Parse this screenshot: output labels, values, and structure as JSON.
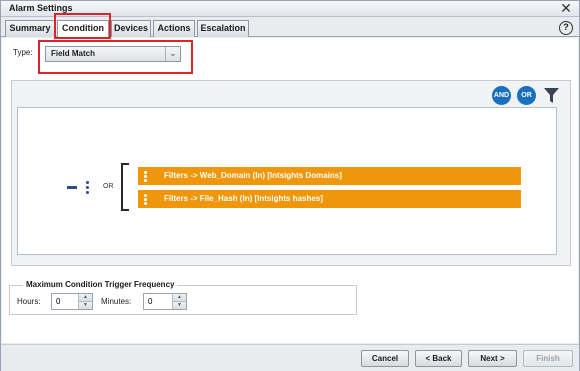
{
  "window": {
    "title": "Alarm Settings",
    "close_glyph": "✕",
    "help_glyph": "?"
  },
  "tabs": [
    {
      "label": "Summary"
    },
    {
      "label": "Condition",
      "active": true
    },
    {
      "label": "Devices"
    },
    {
      "label": "Actions"
    },
    {
      "label": "Escalation"
    }
  ],
  "condition": {
    "type_label": "Type:",
    "type_value": "Field Match",
    "logic_buttons": {
      "and": "AND",
      "or": "OR"
    },
    "group_operator": "OR",
    "filters": [
      {
        "text": "Filters -> Web_Domain (In) [Intsights Domains]"
      },
      {
        "text": "Filters -> File_Hash (In) [Intsights hashes]"
      }
    ]
  },
  "frequency": {
    "title": "Maximum Condition Trigger Frequency",
    "hours_label": "Hours:",
    "hours_value": "0",
    "minutes_label": "Minutes:",
    "minutes_value": "0"
  },
  "footer": {
    "cancel": "Cancel",
    "back": "< Back",
    "next": "Next >",
    "finish": "Finish",
    "finish_enabled": false
  },
  "colors": {
    "filter_bg": "#f0960a",
    "logic_button": "#1b6fc1",
    "highlight": "#d8262c"
  }
}
